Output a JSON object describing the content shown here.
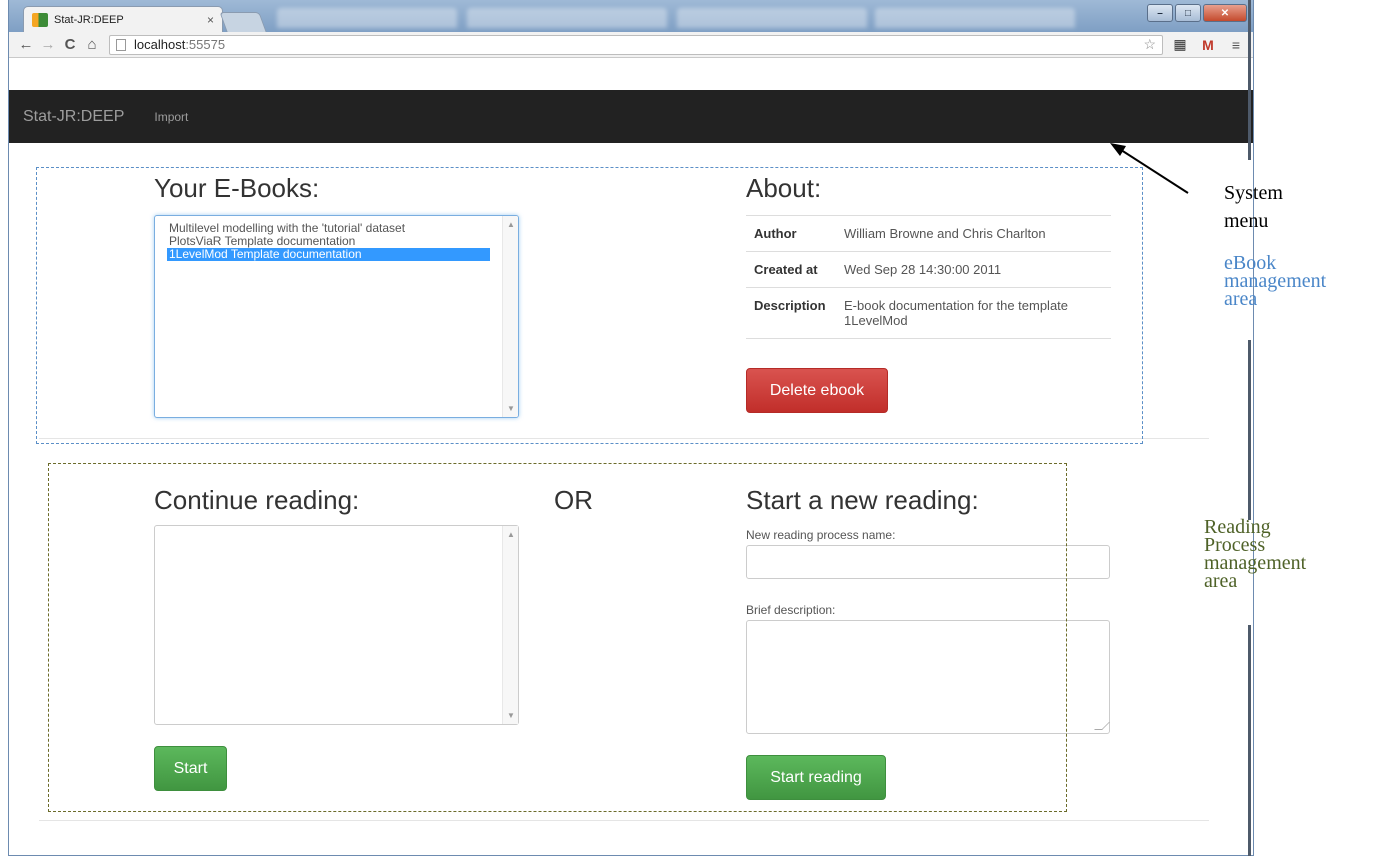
{
  "browser": {
    "tab_title": "Stat-JR:DEEP",
    "tab_close": "×",
    "url_host": "localhost",
    "url_port": ":55575",
    "back_glyph": "←",
    "forward_glyph": "→",
    "reload_glyph": "C",
    "home_glyph": "⌂",
    "star_glyph": "☆",
    "ext_glyph": "▦",
    "mail_glyph": "M",
    "menu_glyph": "≡",
    "window_controls": {
      "minimize": "–",
      "maximize": "□",
      "close": "✕"
    }
  },
  "navbar": {
    "brand": "Stat-JR:DEEP",
    "links": [
      "Import"
    ]
  },
  "ebooks": {
    "heading": "Your E-Books:",
    "items": [
      "Multilevel modelling with the 'tutorial' dataset",
      "PlotsViaR Template documentation",
      "1LevelMod Template documentation"
    ],
    "selected_index": 2
  },
  "about": {
    "heading": "About:",
    "rows": [
      {
        "key": "Author",
        "value": "William Browne and Chris Charlton"
      },
      {
        "key": "Created at",
        "value": "Wed Sep 28 14:30:00 2011"
      },
      {
        "key": "Description",
        "value": "E-book documentation for the template 1LevelMod"
      }
    ],
    "delete_button": "Delete ebook"
  },
  "continue_reading": {
    "heading": "Continue reading:",
    "items": [],
    "start_button": "Start"
  },
  "or_label": "OR",
  "new_reading": {
    "heading": "Start a new reading:",
    "name_label": "New reading process name:",
    "name_value": "",
    "description_label": "Brief description:",
    "description_value": "",
    "start_button": "Start reading"
  },
  "annotations": {
    "system_menu": [
      "System",
      "menu"
    ],
    "ebook_area": [
      "eBook",
      "management",
      "area"
    ],
    "reading_area": [
      "Reading",
      "Process",
      "management",
      "area"
    ]
  },
  "colors": {
    "navbar_bg": "#222222",
    "danger": "#d9534f",
    "success": "#5cb85c",
    "selection": "#3399ff",
    "ebook_annotation": "#4a86c8",
    "reading_annotation": "#4f6228"
  }
}
